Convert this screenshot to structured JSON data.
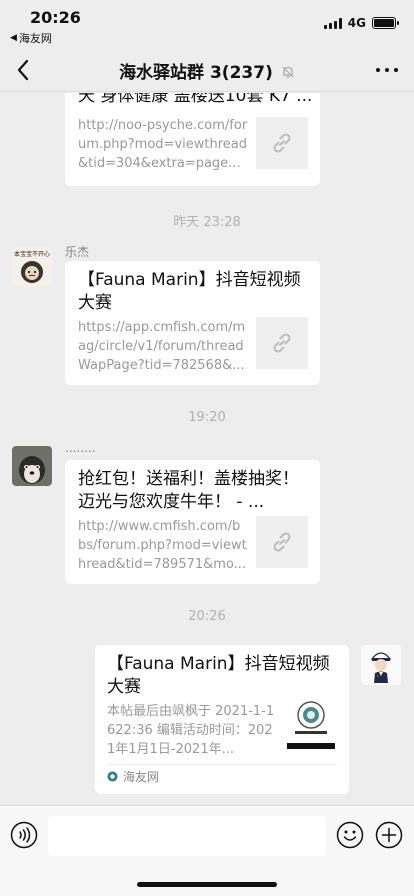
{
  "status_bar": {
    "time": "20:26",
    "back_app": "海友网",
    "network": "4G"
  },
  "nav": {
    "title": "海水驿站群 3(237)",
    "muted_icon": "bell-off-icon",
    "back_icon": "chevron-left-icon",
    "more_icon": "more-dots-icon"
  },
  "messages": [
    {
      "type": "link_card",
      "title": "天 身体健康 盖楼送10套 K7 ...",
      "desc": "http://noo-psyche.com/forum.php?mod=viewthread&tid=304&extra=page...",
      "thumb_icon": "link-icon"
    },
    {
      "type": "timestamp",
      "text": "昨天 23:28"
    },
    {
      "type": "link_card",
      "sender": "乐杰",
      "title": "【Fauna Marin】抖音短视频大赛",
      "desc": "https://app.cmfish.com/mag/circle/v1/forum/threadWapPage?tid=782568&...",
      "thumb_icon": "link-icon"
    },
    {
      "type": "timestamp",
      "text": "19:20"
    },
    {
      "type": "link_card",
      "sender": "........",
      "title": "抢红包！送福利！盖楼抽奖！迈光与您欢度牛年！ - ...",
      "desc": "http://www.cmfish.com/bbs/forum.php?mod=viewthread&tid=789571&mo...",
      "thumb_icon": "link-icon"
    },
    {
      "type": "timestamp",
      "text": "20:26"
    },
    {
      "type": "mini_card",
      "title": "【Fauna Marin】抖音短视频大赛",
      "desc": "本帖最后由飒枫于 2021-1-1622:36 编辑活动时间：2021年1月1日-2021年...",
      "source": "海友网"
    }
  ],
  "inputbar": {
    "voice_icon": "voice-icon",
    "emoji_icon": "emoji-icon",
    "plus_icon": "plus-circle-icon"
  },
  "colors": {
    "background": "#ededed",
    "card": "#ffffff",
    "timestamp": "#b2b2b2",
    "desc": "#999999"
  }
}
